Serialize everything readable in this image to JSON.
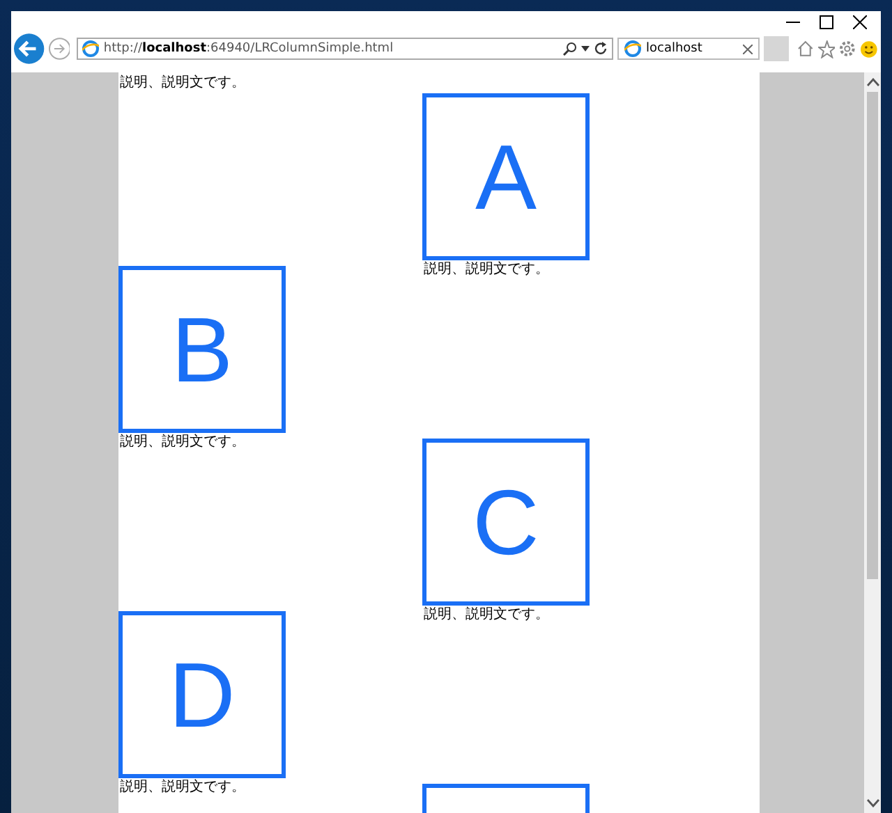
{
  "address_bar": {
    "url": "http://**localhost**:64940/LRColumnSimple.html"
  },
  "tabs": [
    {
      "label": "localhost",
      "selected": true
    }
  ],
  "page": {
    "items": [
      {
        "kind": "left",
        "caption": "説明、説明文です。"
      },
      {
        "kind": "right",
        "letter": "A",
        "caption": "説明、説明文です。"
      },
      {
        "kind": "left",
        "letter": "B",
        "caption": "説明、説明文です。"
      },
      {
        "kind": "right",
        "letter": "C",
        "caption": "説明、説明文です。"
      },
      {
        "kind": "left",
        "letter": "D",
        "caption": "説明、説明文です。"
      },
      {
        "kind": "right"
      }
    ]
  }
}
